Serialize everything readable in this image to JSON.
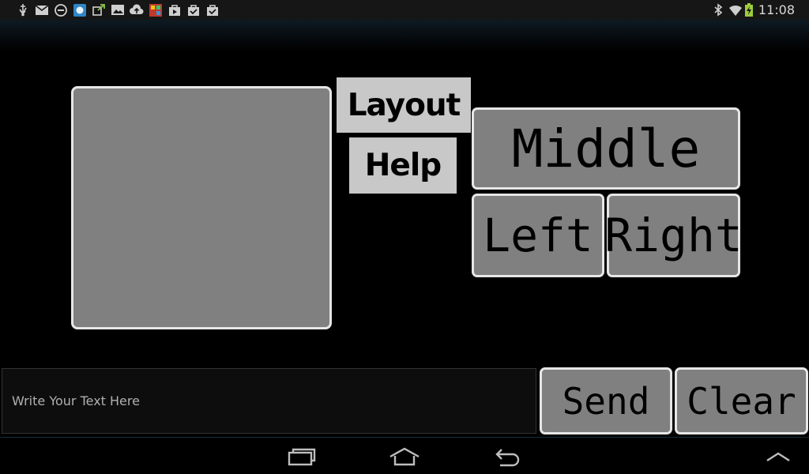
{
  "status_bar": {
    "time": "11:08",
    "notification_icons": [
      "usb-icon",
      "gmail-icon",
      "do-not-disturb-icon",
      "app-icon",
      "sync-icon",
      "image-icon",
      "cloud-upload-icon",
      "game-icon",
      "play-store-icon",
      "download-done-icon",
      "download-done-icon"
    ],
    "system_icons": [
      "bluetooth-icon",
      "wifi-icon",
      "battery-charging-icon"
    ]
  },
  "panel": {
    "layout_label": "Layout",
    "help_label": "Help"
  },
  "mouse_buttons": {
    "middle_label": "Middle",
    "left_label": "Left",
    "right_label": "Right"
  },
  "composer": {
    "placeholder": "Write Your Text Here",
    "value": "",
    "send_label": "Send",
    "clear_label": "Clear"
  },
  "nav_bar": {
    "icons": [
      "recent-apps-icon",
      "home-icon",
      "back-icon",
      "menu-up-icon"
    ]
  },
  "colors": {
    "background": "#000000",
    "button_gray": "#808080",
    "button_border": "#e6e6e6",
    "label_bg": "#c8c8c8"
  }
}
